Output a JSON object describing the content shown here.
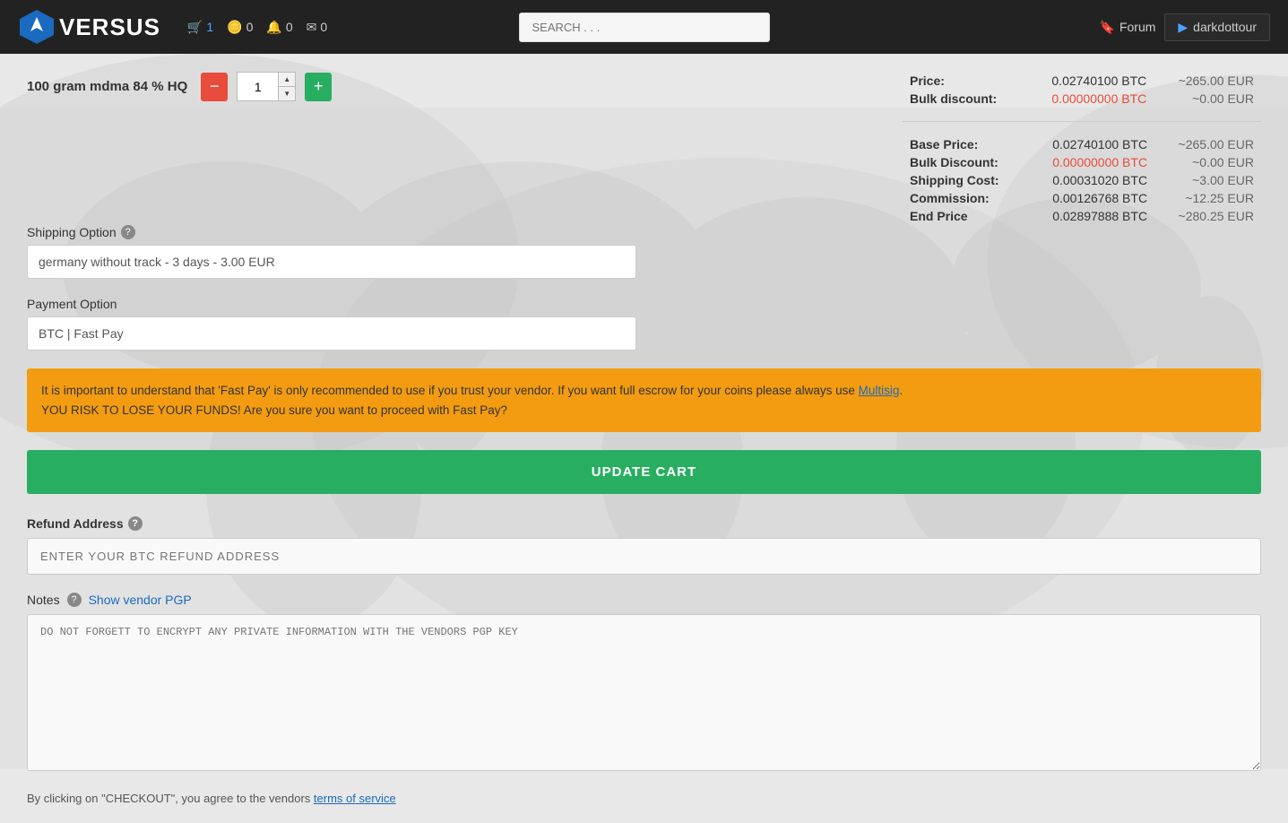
{
  "header": {
    "logo_text": "VERSUS",
    "cart_label": "1",
    "coins_label": "0",
    "notifications_label": "0",
    "messages_label": "0",
    "search_placeholder": "SEARCH . . .",
    "forum_label": "Forum",
    "user_label": "darkdottour"
  },
  "product": {
    "title": "100 gram mdma 84 % HQ",
    "quantity": "1",
    "price_label": "Price:",
    "price_btc": "0.02740100 BTC",
    "price_eur": "~265.00 EUR",
    "bulk_discount_label": "Bulk discount:",
    "bulk_discount_btc": "0.00000000 BTC",
    "bulk_discount_eur": "~0.00 EUR"
  },
  "price_summary": {
    "base_price_label": "Base Price:",
    "base_price_btc": "0.02740100 BTC",
    "base_price_eur": "~265.00 EUR",
    "bulk_discount_label": "Bulk Discount:",
    "bulk_discount_btc": "0.00000000 BTC",
    "bulk_discount_eur": "~0.00 EUR",
    "shipping_cost_label": "Shipping Cost:",
    "shipping_cost_btc": "0.00031020 BTC",
    "shipping_cost_eur": "~3.00 EUR",
    "commission_label": "Commission:",
    "commission_btc": "0.00126768 BTC",
    "commission_eur": "~12.25 EUR",
    "end_price_label": "End Price",
    "end_price_btc": "0.02897888 BTC",
    "end_price_eur": "~280.25 EUR"
  },
  "shipping": {
    "label": "Shipping Option",
    "value": "germany without track - 3 days - 3.00 EUR"
  },
  "payment": {
    "label": "Payment Option",
    "value": "BTC | Fast Pay"
  },
  "warning": {
    "text1": "It is important to understand that 'Fast Pay' is only recommended to use if you trust your vendor. If you want full escrow for your coins please always use ",
    "link_text": "Multisig",
    "text2": ".",
    "text3": "YOU RISK TO LOSE YOUR FUNDS! Are you sure you want to proceed with Fast Pay?"
  },
  "buttons": {
    "update_cart": "UPDATE CART"
  },
  "refund": {
    "label": "Refund Address",
    "placeholder": "ENTER YOUR BTC REFUND ADDRESS"
  },
  "notes": {
    "label": "Notes",
    "show_pgp_label": "Show vendor PGP",
    "placeholder": "DO NOT FORGETT TO ENCRYPT ANY PRIVATE INFORMATION WITH THE VENDORS PGP KEY"
  },
  "terms": {
    "text": "By clicking on \"CHECKOUT\", you agree to the vendors ",
    "link_text": "terms of service"
  }
}
